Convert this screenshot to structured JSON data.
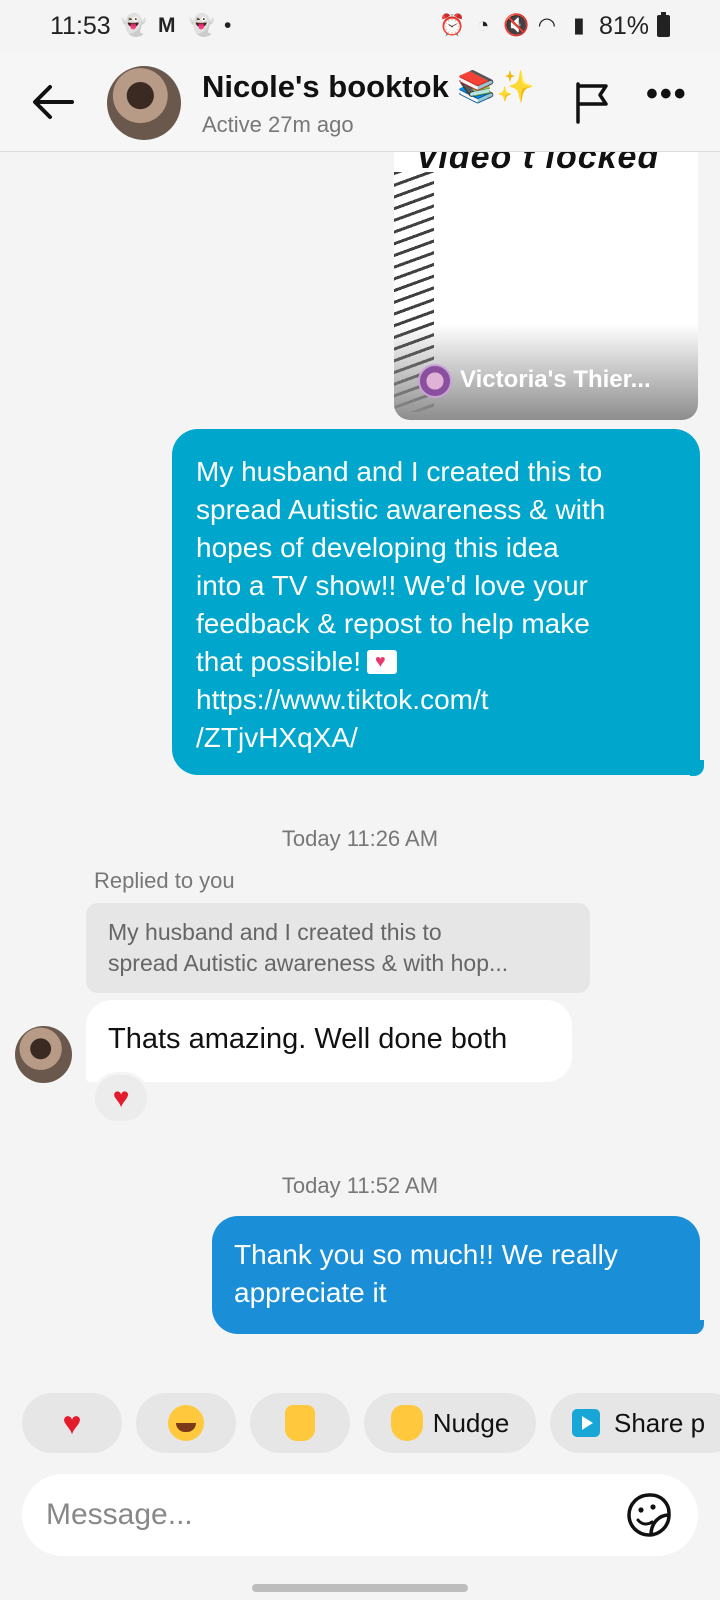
{
  "status_bar": {
    "time": "11:53",
    "notif_icons": [
      "snapchat-icon",
      "gmail-icon",
      "snapchat-icon",
      "dot-icon"
    ],
    "system_icons": [
      "alarm-icon",
      "clock-icon",
      "mute-icon",
      "wifi-icon",
      "signal-icon"
    ],
    "battery": "81%"
  },
  "header": {
    "title": "Nicole's booktok 📚✨",
    "subtitle": "Active 27m ago"
  },
  "shared_video": {
    "overlay_text": "Video t   locked",
    "author": "Victoria's Thier..."
  },
  "messages": {
    "sent_1_lines": [
      "My husband and I created this to",
      "spread Autistic awareness & with",
      "hopes of developing this idea",
      "into a TV show!! We'd love your",
      "feedback & repost to help make",
      "that possible!"
    ],
    "sent_1_link_lines": [
      "https://www.tiktok.com/t",
      "/ZTjvHXqXA/"
    ],
    "timestamp_1": "Today 11:26 AM",
    "replied_label": "Replied to you",
    "quote_lines": [
      "My husband and I created this to",
      "spread Autistic awareness & with hop..."
    ],
    "received_1": "Thats amazing. Well done both",
    "reaction_1": "♥",
    "timestamp_2": "Today 11:52 AM",
    "sent_2_lines": [
      "Thank you so much!! We really",
      "appreciate it"
    ]
  },
  "quick_replies": {
    "heart": "♥",
    "nudge": "Nudge",
    "share": "Share p"
  },
  "composer": {
    "placeholder": "Message..."
  },
  "colors": {
    "teal_bubble": "#00a6cb",
    "blue_bubble": "#1a8ed6",
    "background": "#f4f4f4"
  }
}
